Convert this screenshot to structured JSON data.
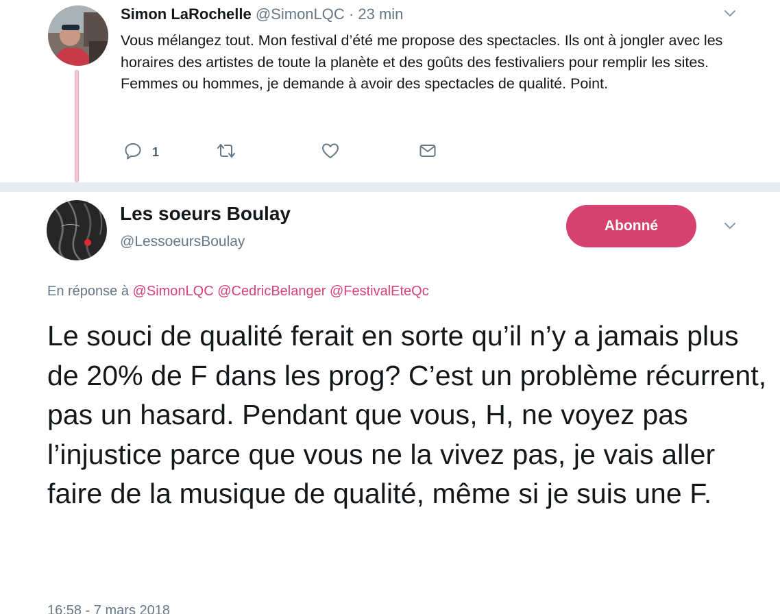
{
  "reply_tweet": {
    "author_name": "Simon LaRochelle",
    "handle": "@SimonLQC",
    "separator": "·",
    "time": "23 min",
    "text": "Vous mélangez tout. Mon festival d’été me propose des spectacles. Ils ont à jongler avec les horaires des artistes de toute la planète et des goûts des festivaliers pour remplir les sites. Femmes ou hommes, je demande à avoir des spectacles de qualité. Point.",
    "actions": {
      "reply_count": "1",
      "retweet_count": "",
      "like_count": ""
    },
    "icons": [
      "reply-icon",
      "retweet-icon",
      "heart-icon",
      "envelope-icon",
      "chevron-down-icon"
    ]
  },
  "main_tweet": {
    "author_name": "Les soeurs Boulay",
    "handle": "@LessoeursBoulay",
    "follow_label": "Abonné",
    "reply_prefix": "En réponse à",
    "mentions": [
      "@SimonLQC",
      "@CedricBelanger",
      "@FestivalEteQc"
    ],
    "text": "Le souci de qualité ferait en sorte qu’il n’y a jamais plus de 20% de F dans les prog? C’est un problème récurrent, pas un hasard. Pendant que vous, H, ne voyez pas l’injustice parce que vous ne la vivez pas, je vais aller faire de la musique de qualité, même si je suis une F.",
    "timestamp": "16:58 - 7 mars 2018"
  },
  "colors": {
    "accent": "#d6426f",
    "thread_line": "#f3c6d2",
    "muted_text": "#657786",
    "background": "#e6ecf0"
  }
}
